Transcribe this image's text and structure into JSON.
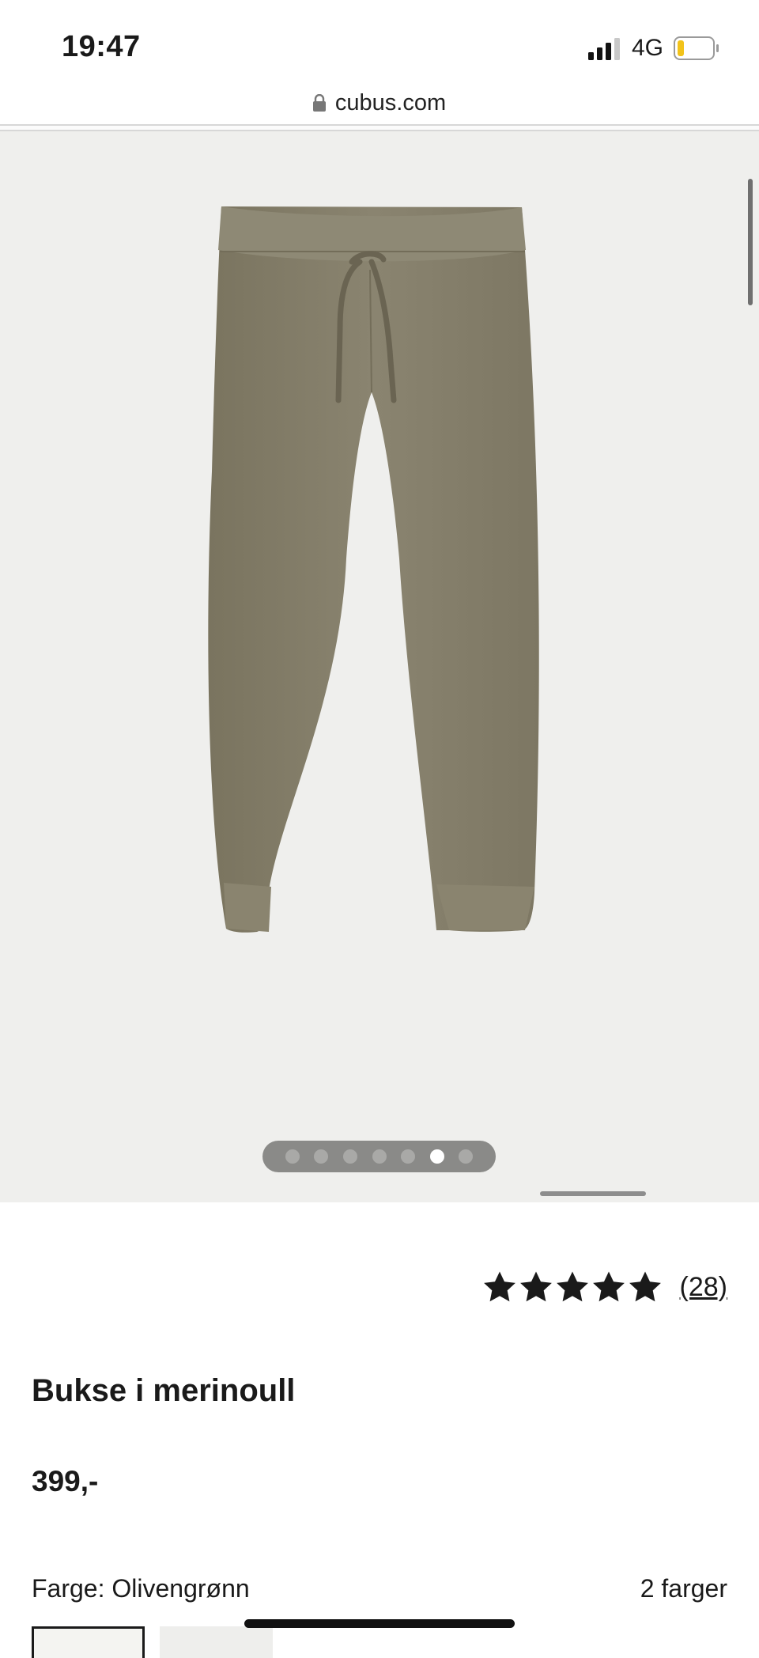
{
  "status_bar": {
    "time": "19:47",
    "network": "4G",
    "signal_icon": "cellular-signal-icon",
    "battery_icon": "battery-icon",
    "battery_color": "#f2c31a"
  },
  "browser": {
    "url": "cubus.com",
    "lock_icon": "lock-icon"
  },
  "gallery": {
    "image_count": 7,
    "active_index": 5,
    "background_color": "#efefed",
    "product_color": "#857f6b"
  },
  "product": {
    "rating_stars": 5,
    "review_count": "(28)",
    "title": "Bukse i merinoull",
    "price": "399,-",
    "color_label": "Farge: Olivengrønn",
    "color_count": "2 farger"
  }
}
